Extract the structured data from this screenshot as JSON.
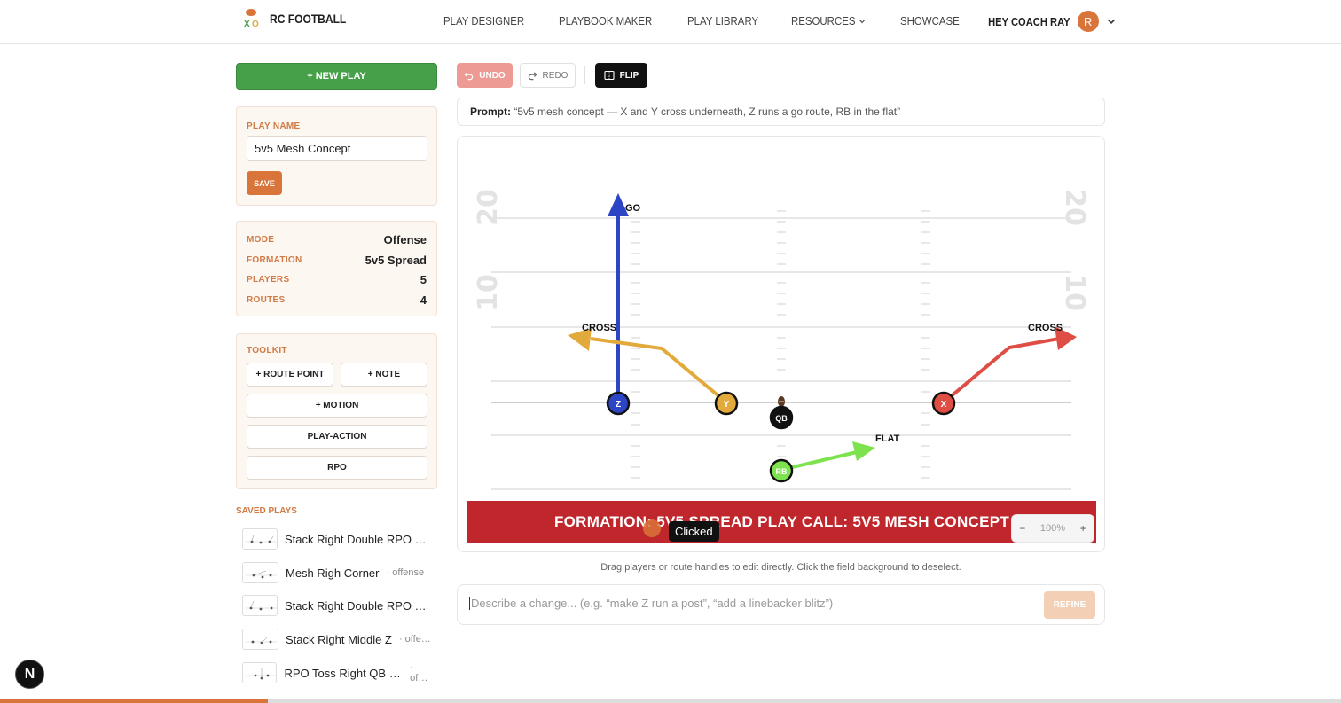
{
  "brand": {
    "name": "RC FOOTBALL"
  },
  "nav": {
    "items": [
      "PLAY DESIGNER",
      "PLAYBOOK MAKER",
      "PLAY LIBRARY",
      "RESOURCES",
      "SHOWCASE"
    ]
  },
  "user": {
    "greeting": "HEY COACH RAY",
    "initial": "R"
  },
  "sidebar": {
    "new_play_label": "+ NEW PLAY",
    "play_name_label": "PLAY NAME",
    "play_name_value": "5v5 Mesh Concept",
    "save_label": "SAVE",
    "meta": [
      {
        "label": "MODE",
        "value": "Offense"
      },
      {
        "label": "FORMATION",
        "value": "5v5 Spread"
      },
      {
        "label": "PLAYERS",
        "value": "5"
      },
      {
        "label": "ROUTES",
        "value": "4"
      }
    ],
    "toolkit_label": "TOOLKIT",
    "toolkit": [
      "+ ROUTE POINT",
      "+ NOTE",
      "+ MOTION",
      "PLAY-ACTION",
      "RPO"
    ],
    "saved_title": "SAVED PLAYS",
    "saved_plays": [
      {
        "name": "Stack Right Double RPO Y …",
        "type": ""
      },
      {
        "name": "Mesh Righ Corner",
        "type": " · offense"
      },
      {
        "name": "Stack Right Double RPO Y …",
        "type": ""
      },
      {
        "name": "Stack Right Middle Z",
        "type": " · offe…"
      },
      {
        "name": "RPO Toss Right QB Mid",
        "type": " · of…"
      }
    ]
  },
  "toolbar": {
    "undo": "UNDO",
    "redo": "REDO",
    "flip": "FLIP"
  },
  "prompt": {
    "label": "Prompt:",
    "text": "“5v5 mesh concept — X and Y cross underneath, Z runs a go route, RB in the flat”"
  },
  "field": {
    "yard_numbers": [
      "20",
      "10"
    ],
    "players": [
      "Z",
      "Y",
      "QB",
      "X",
      "RB"
    ],
    "route_labels": [
      "GO",
      "CROSS",
      "CROSS",
      "FLAT"
    ],
    "colors": {
      "z": "#2b45c4",
      "y": "#e2a93b",
      "x": "#de4e45",
      "rb": "#7ee24f",
      "qb": "#111111"
    },
    "banner": "FORMATION: 5V5 SPREAD PLAY CALL: 5V5 MESH CONCEPT",
    "zoom": "100%",
    "clicked_tip": "Clicked"
  },
  "hint": "Drag players or route handles to edit directly. Click the field background to deselect.",
  "refine": {
    "placeholder": "Describe a change... (e.g. “make Z run a post”, “add a linebacker blitz”)",
    "button": "REFINE"
  },
  "badge": "N"
}
